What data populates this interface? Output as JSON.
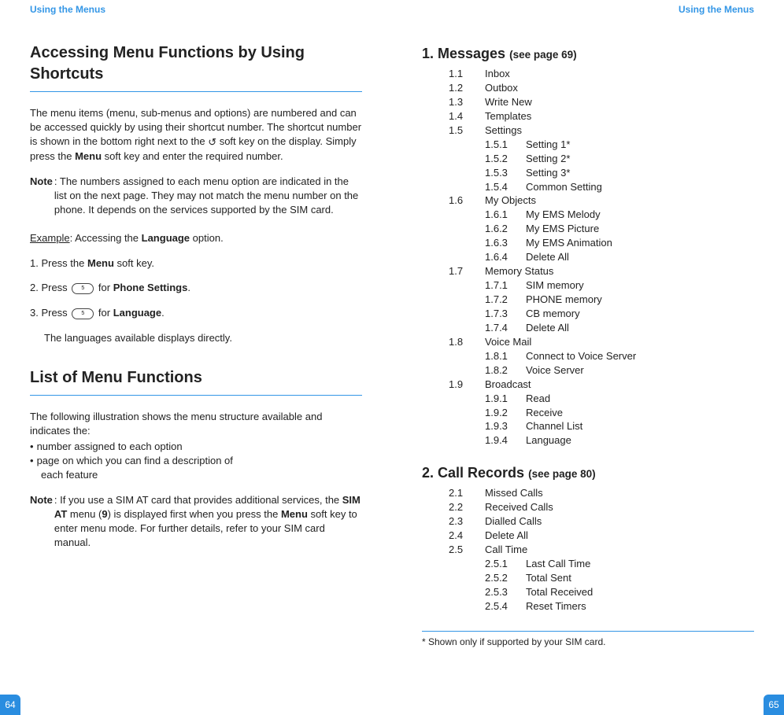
{
  "left": {
    "running_head": "Using the Menus",
    "page_number": "64",
    "h1a": "Accessing Menu Functions by Using Shortcuts",
    "para1_full": "The menu items (menu, sub-menus and options) are numbered and can be accessed quickly by using their shortcut number. The shortcut number is shown in the bottom right next to the ",
    "para1_tail1": " soft key on the display. Simply press the ",
    "para1_tail2": "Menu",
    "para1_tail3": " soft key and enter the required number.",
    "note1_label": "Note",
    "note1_text": ": The numbers assigned to each menu option are indicated in the list on the next page. They may not match the menu number on the phone. It depends on the services supported by the SIM card.",
    "example_label": "Example",
    "example_mid": ": Accessing the ",
    "example_bold": "Language",
    "example_end": " option.",
    "step1_a": "1. Press the ",
    "step1_b": "Menu",
    "step1_c": " soft key.",
    "step2_a": "2. Press ",
    "step2_key": "5",
    "step2_b": " for ",
    "step2_bold": "Phone Settings",
    "step2_c": ".",
    "step3_a": "3. Press ",
    "step3_key": "5",
    "step3_b": " for ",
    "step3_bold": "Language",
    "step3_c": ".",
    "step_result": "The languages available displays directly.",
    "h1b": "List of Menu Functions",
    "para2": "The following illustration shows the menu structure available and indicates the:",
    "bullet1": "number assigned to each option",
    "bullet2a": "page on which you can find a description of",
    "bullet2b": "each feature",
    "note2_label": "Note",
    "note2_a": ": If you use a SIM AT card that provides additional services, the ",
    "note2_b": "SIM AT",
    "note2_c": " menu (",
    "note2_d": "9",
    "note2_e": ") is displayed first when you press the ",
    "note2_f": "Menu",
    "note2_g": " soft key to enter menu mode. For further details, refer to your SIM card manual."
  },
  "right": {
    "running_head": "Using the Menus",
    "page_number": "65",
    "section1": {
      "title": "1. Messages",
      "ref": "(see page 69)",
      "items": [
        {
          "n": "1.1",
          "t": "Inbox"
        },
        {
          "n": "1.2",
          "t": "Outbox"
        },
        {
          "n": "1.3",
          "t": "Write New"
        },
        {
          "n": "1.4",
          "t": "Templates"
        },
        {
          "n": "1.5",
          "t": "Settings",
          "sub": [
            {
              "n": "1.5.1",
              "t": "Setting 1*"
            },
            {
              "n": "1.5.2",
              "t": "Setting 2*"
            },
            {
              "n": "1.5.3",
              "t": "Setting 3*"
            },
            {
              "n": "1.5.4",
              "t": "Common Setting"
            }
          ]
        },
        {
          "n": "1.6",
          "t": "My Objects",
          "sub": [
            {
              "n": "1.6.1",
              "t": "My EMS Melody"
            },
            {
              "n": "1.6.2",
              "t": "My EMS Picture"
            },
            {
              "n": "1.6.3",
              "t": "My EMS Animation"
            },
            {
              "n": "1.6.4",
              "t": "Delete All"
            }
          ]
        },
        {
          "n": "1.7",
          "t": "Memory Status",
          "sub": [
            {
              "n": "1.7.1",
              "t": "SIM memory"
            },
            {
              "n": "1.7.2",
              "t": "PHONE memory"
            },
            {
              "n": "1.7.3",
              "t": "CB memory"
            },
            {
              "n": "1.7.4",
              "t": "Delete All"
            }
          ]
        },
        {
          "n": "1.8",
          "t": "Voice Mail",
          "sub": [
            {
              "n": "1.8.1",
              "t": "Connect to Voice Server"
            },
            {
              "n": "1.8.2",
              "t": "Voice Server"
            }
          ]
        },
        {
          "n": "1.9",
          "t": "Broadcast",
          "sub": [
            {
              "n": "1.9.1",
              "t": "Read"
            },
            {
              "n": "1.9.2",
              "t": "Receive"
            },
            {
              "n": "1.9.3",
              "t": "Channel List"
            },
            {
              "n": "1.9.4",
              "t": "Language"
            }
          ]
        }
      ]
    },
    "section2": {
      "title": "2. Call Records",
      "ref": "(see page 80)",
      "items": [
        {
          "n": "2.1",
          "t": "Missed Calls"
        },
        {
          "n": "2.2",
          "t": "Received Calls"
        },
        {
          "n": "2.3",
          "t": "Dialled Calls"
        },
        {
          "n": "2.4",
          "t": "Delete All"
        },
        {
          "n": "2.5",
          "t": "Call Time",
          "sub": [
            {
              "n": "2.5.1",
              "t": "Last Call Time"
            },
            {
              "n": "2.5.2",
              "t": "Total Sent"
            },
            {
              "n": "2.5.3",
              "t": "Total Received"
            },
            {
              "n": "2.5.4",
              "t": "Reset Timers"
            }
          ]
        }
      ]
    },
    "footnote": "* Shown only if supported by your SIM card."
  }
}
